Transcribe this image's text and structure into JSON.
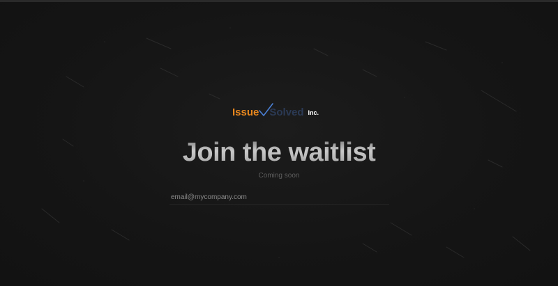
{
  "logo": {
    "word1": "Issue",
    "word2": "Solved",
    "suffix": "Inc.",
    "word1_color": "#e8871e",
    "word2_color": "#2b3a55",
    "check_color": "#4a7fd4",
    "icon": "checkmark-icon"
  },
  "hero": {
    "title": "Join the waitlist",
    "subtitle": "Coming soon"
  },
  "signup": {
    "email_placeholder": "email@mycompany.com",
    "email_value": ""
  },
  "colors": {
    "background": "#151515"
  }
}
